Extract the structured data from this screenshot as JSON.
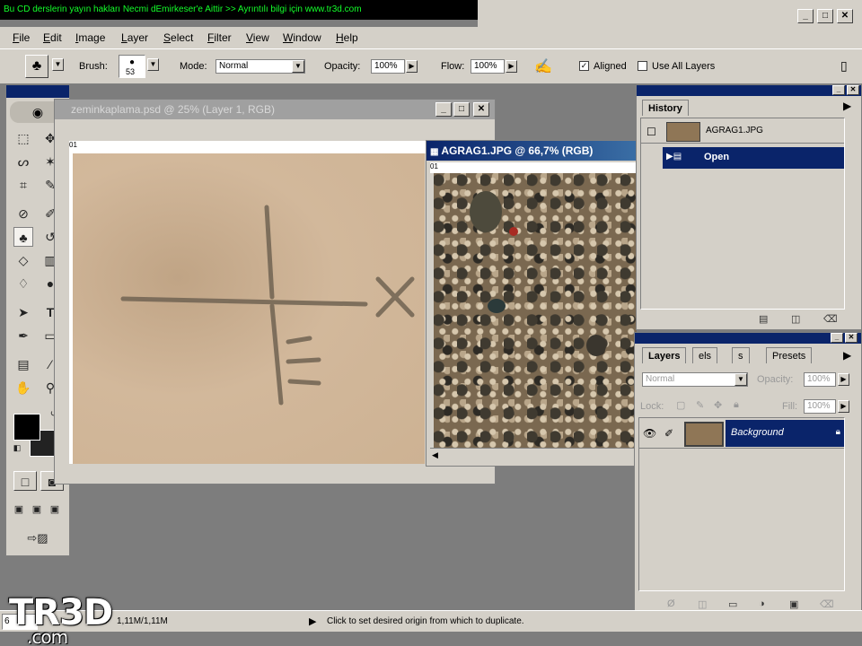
{
  "banner": {
    "text": "Bu CD derslerin yayın hakları Necmi dEmirkeser'e Aittir >> Ayrıntılı bilgi için  www.tr3d.com"
  },
  "window_controls": {
    "minimize": "_",
    "maximize": "□",
    "close": "✕"
  },
  "menu": [
    "File",
    "Edit",
    "Image",
    "Layer",
    "Select",
    "Filter",
    "View",
    "Window",
    "Help"
  ],
  "options": {
    "brush_label": "Brush:",
    "brush_size": "53",
    "mode_label": "Mode:",
    "mode_value": "Normal",
    "opacity_label": "Opacity:",
    "opacity_value": "100%",
    "flow_label": "Flow:",
    "flow_value": "100%",
    "aligned_label": "Aligned",
    "aligned_checked": "✓",
    "use_all_layers_label": "Use All Layers"
  },
  "documents": {
    "doc1": {
      "title": "zeminkaplama.psd @ 25% (Layer 1, RGB)",
      "ruler_label": "01"
    },
    "doc2": {
      "title": "AGRAG1.JPG @ 66,7% (RGB)",
      "ruler_label": "01"
    }
  },
  "history": {
    "tab": "History",
    "snapshot_label": "AGRAG1.JPG",
    "items": [
      {
        "label": "Open"
      }
    ]
  },
  "layers": {
    "tabs": [
      "Layers",
      "Channels",
      "Paths",
      "Presets"
    ],
    "tabs_visible": [
      "Layers",
      "els",
      "s",
      "Presets"
    ],
    "blend_mode": "Normal",
    "opacity_label": "Opacity:",
    "opacity_value": "100%",
    "lock_label": "Lock:",
    "fill_label": "Fill:",
    "fill_value": "100%",
    "layer_name": "Background"
  },
  "status": {
    "zoom": "6",
    "doc_size": "1,11M/1,11M",
    "message": "Click to set desired origin from which to duplicate."
  },
  "watermark": {
    "logo": "TR3D",
    "domain": ".com"
  },
  "colors": {
    "accent": "#0a246a",
    "banner_text": "#13ff2a",
    "canvas_bg": "#7d7d7d"
  }
}
